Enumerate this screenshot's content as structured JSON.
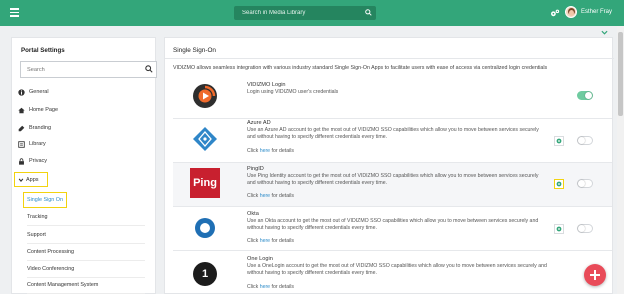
{
  "topbar": {
    "search_placeholder": "Search in Media Library",
    "user_name": "Esther Fray"
  },
  "left": {
    "title": "Portal Settings",
    "search_placeholder": "Search",
    "menu": [
      {
        "label": "General",
        "icon": "info-icon"
      },
      {
        "label": "Home Page",
        "icon": "home-icon"
      },
      {
        "label": "Branding",
        "icon": "branding-icon"
      },
      {
        "label": "Library",
        "icon": "library-icon"
      },
      {
        "label": "Privacy",
        "icon": "lock-icon"
      }
    ],
    "apps_label": "Apps",
    "submenu": [
      {
        "label": "Single Sign On"
      },
      {
        "label": "Tracking"
      },
      {
        "label": "Support"
      },
      {
        "label": "Content Processing"
      },
      {
        "label": "Video Conferencing"
      },
      {
        "label": "Content Management System"
      }
    ]
  },
  "main": {
    "title": "Single Sign-On",
    "intro": "VIDIZMO allows seamless integration with various industry standard Single Sign-On Apps to facilitate users with ease of access via centralized login credentials",
    "click_prefix": "Click ",
    "click_link": "here",
    "click_suffix": " for details",
    "apps": [
      {
        "name": "VIDIZMO Login",
        "desc": "Login using VIDIZMO user's credentials",
        "enabled": true
      },
      {
        "name": "Azure AD",
        "desc": "Use an Azure AD account to get the most out of VIDIZMO SSO capabilities which allow you to move between services securely and without having to specify different credentials every time.",
        "enabled": false
      },
      {
        "name": "PingID",
        "desc": "Use Ping Identity account to get the most out of VIDIZMO SSO capabilities which allow you to move between services securely and without having to specify different credentials every time.",
        "enabled": false,
        "logo_text": "Ping"
      },
      {
        "name": "Okta",
        "desc": "Use an Okta account to get the most out of VIDIZMO SSO capabilities which allow you to move between services securely and without having to specify different credentials every time.",
        "enabled": false
      },
      {
        "name": "One Login",
        "desc": "Use a OneLogin account to get the most out of VIDIZMO SSO capabilities which allow you to move between services securely and without having to specify different credentials every time.",
        "enabled": false,
        "logo_text": "1"
      }
    ]
  },
  "colors": {
    "brand": "#33a67a",
    "highlight": "#f2d30f",
    "link": "#2e8cc9",
    "fab": "#e94b59"
  }
}
